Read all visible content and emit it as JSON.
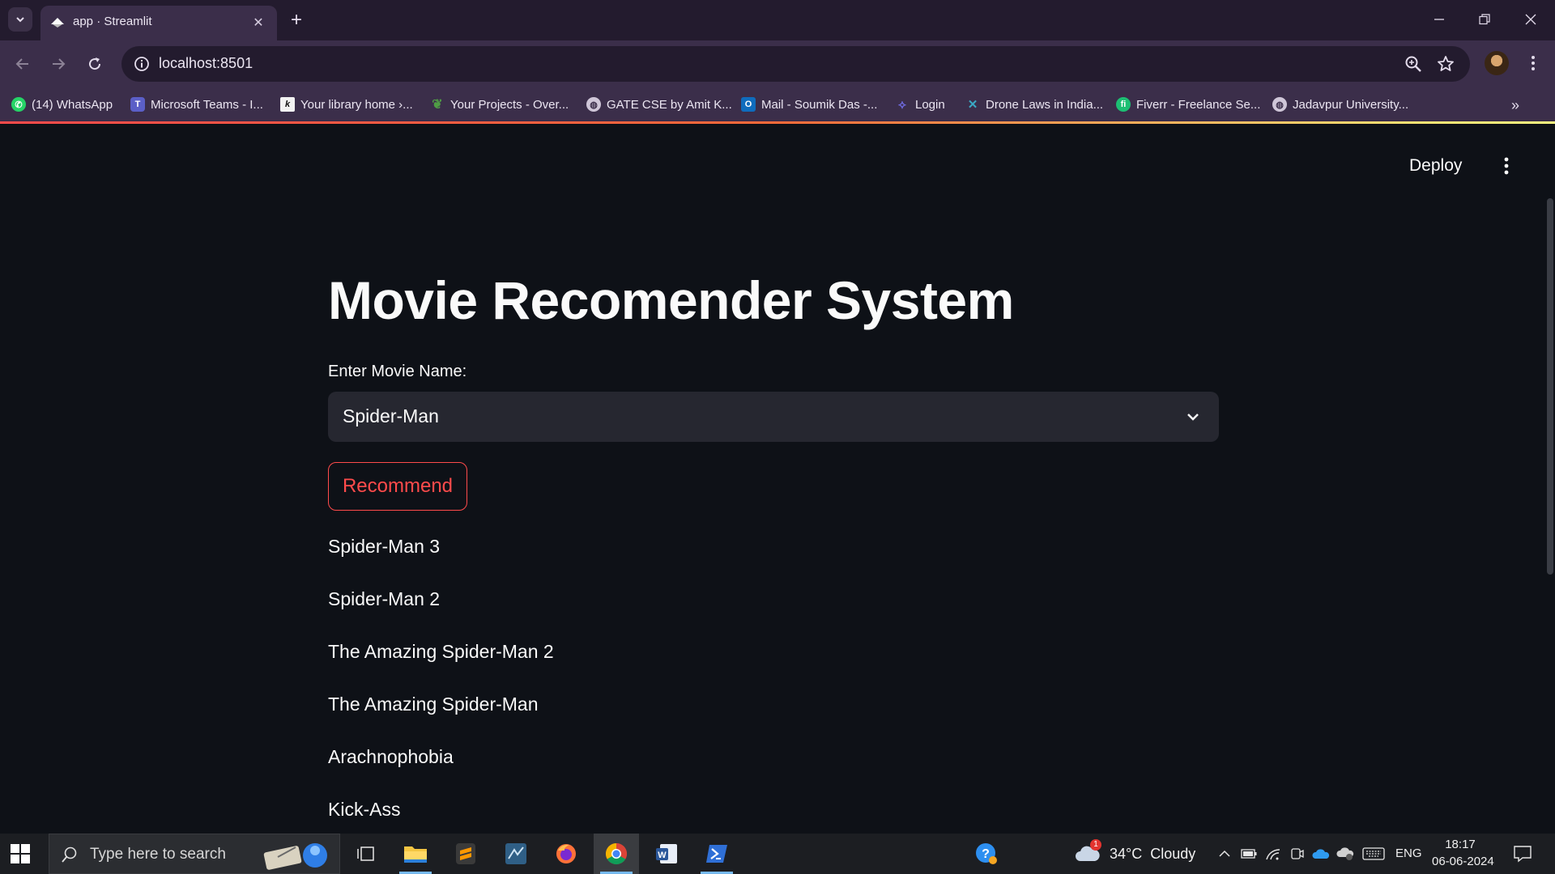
{
  "browser": {
    "tab_title": "app · Streamlit",
    "url": "localhost:8501",
    "bookmarks": [
      {
        "label": "(14) WhatsApp",
        "icon": "whatsapp-icon",
        "color": "#25d366"
      },
      {
        "label": "Microsoft Teams - I...",
        "icon": "teams-icon",
        "color": "#5b5fc7"
      },
      {
        "label": "Your library home ›...",
        "icon": "kindle-icon",
        "color": "#f2f2f2"
      },
      {
        "label": "Your Projects - Over...",
        "icon": "overleaf-icon",
        "color": "#4f9c45"
      },
      {
        "label": "GATE CSE by Amit K...",
        "icon": "globe-icon",
        "color": "#cfc6d8"
      },
      {
        "label": "Mail - Soumik Das -...",
        "icon": "outlook-icon",
        "color": "#0f6cbd"
      },
      {
        "label": "Login",
        "icon": "login-icon",
        "color": "#6e6adf"
      },
      {
        "label": "Drone Laws in India...",
        "icon": "drone-icon",
        "color": "#3aa9c4"
      },
      {
        "label": "Fiverr - Freelance Se...",
        "icon": "fiverr-icon",
        "color": "#1dbf73"
      },
      {
        "label": "Jadavpur University...",
        "icon": "globe-icon",
        "color": "#cfc6d8"
      }
    ]
  },
  "app": {
    "deploy_label": "Deploy",
    "title": "Movie Recomender System",
    "select_label": "Enter Movie Name:",
    "selected_movie": "Spider-Man",
    "button_label": "Recommend",
    "recommendations": [
      "Spider-Man 3",
      "Spider-Man 2",
      "The Amazing Spider-Man 2",
      "The Amazing Spider-Man",
      "Arachnophobia",
      "Kick-Ass"
    ],
    "accent_color": "#ff4b4b"
  },
  "taskbar": {
    "search_placeholder": "Type here to search",
    "weather": "34°C  Cloudy",
    "weather_badge": "1",
    "language": "ENG",
    "time": "18:17",
    "date": "06-06-2024"
  }
}
